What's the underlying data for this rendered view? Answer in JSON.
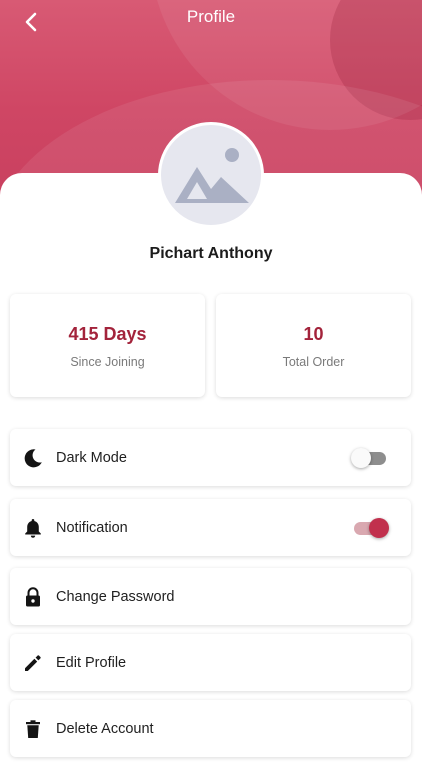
{
  "header": {
    "title": "Profile",
    "back_icon": "chevron-left-icon"
  },
  "profile": {
    "avatar_icon": "image-placeholder-icon",
    "name": "Pichart Anthony"
  },
  "stats": [
    {
      "value": "415 Days",
      "label": "Since Joining"
    },
    {
      "value": "10",
      "label": "Total Order"
    }
  ],
  "menu": [
    {
      "icon": "moon-icon",
      "label": "Dark Mode",
      "toggle": false
    },
    {
      "icon": "bell-icon",
      "label": "Notification",
      "toggle": true
    },
    {
      "icon": "lock-icon",
      "label": "Change Password"
    },
    {
      "icon": "pencil-icon",
      "label": "Edit Profile"
    },
    {
      "icon": "trash-icon",
      "label": "Delete Account"
    }
  ],
  "colors": {
    "header": "#cf4664",
    "accent": "#a3233b",
    "toggle_on": "#c1304d",
    "toggle_off": "#8e8e8e"
  }
}
